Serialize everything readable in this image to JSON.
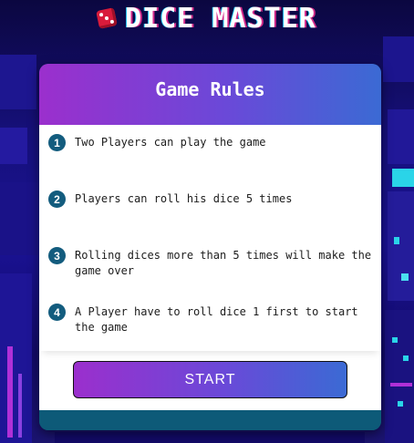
{
  "app": {
    "title": "DICE MASTER",
    "title_icon": "dice-icon"
  },
  "rules_card": {
    "heading": "Game Rules",
    "rules": [
      {
        "number": "1",
        "text": "Two Players can play the game"
      },
      {
        "number": "2",
        "text": "Players can roll his dice 5 times"
      },
      {
        "number": "3",
        "text": "Rolling dices more than 5 times will make the game over"
      },
      {
        "number": "4",
        "text": "A Player have to roll dice 1 first to start the game"
      }
    ],
    "start_label": "START"
  },
  "colors": {
    "accent_gradient_start": "#9b2fcd",
    "accent_gradient_end": "#3b6ad4",
    "number_badge": "#135c7e",
    "card_footer": "#0d5a78",
    "background": "#16107a"
  }
}
